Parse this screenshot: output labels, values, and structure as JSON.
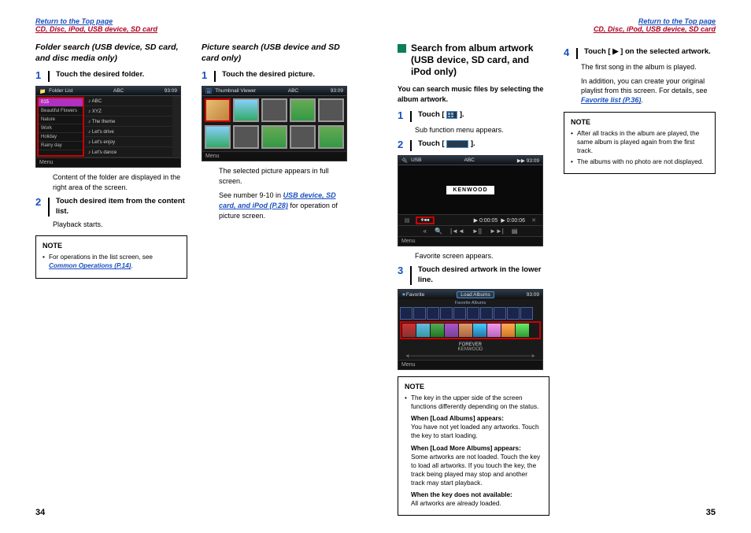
{
  "topLink": "Return to the Top page",
  "breadcrumb": "CD, Disc, iPod, USB device, SD card",
  "pageLeft": "34",
  "pageRight": "35",
  "left": {
    "colA": {
      "title": "Folder search (USB device, SD card, and disc media only)",
      "step1": "Touch the desired folder.",
      "bodyAfterShot": "Content of the folder are displayed in the right area of the screen.",
      "step2": "Touch desired item from the content list.",
      "step2sub": "Playback starts.",
      "noteTitle": "NOTE",
      "noteItemPrefix": "For operations in the list screen, see ",
      "noteLink": "Common Operations (P.14)",
      "noteItemSuffix": ".",
      "shot": {
        "header": "Folder List",
        "headerMid": "ABC",
        "headerRight": "93:09",
        "leftItems": [
          "015",
          "Beautiful Flowers",
          "Nature",
          "Work",
          "Holiday",
          "Rainy day"
        ],
        "rightItems": [
          "♪ ABC",
          "♪ XYZ",
          "♪ The theme",
          "♪ Let's drive",
          "♪ Let's enjoy",
          "♪ Let's dance"
        ],
        "menu": "Menu"
      }
    },
    "colB": {
      "title": "Picture search (USB device and SD card only)",
      "step1": "Touch the desired picture.",
      "afterShot1": "The selected picture appears in full screen.",
      "afterShot2a": "See number 9-10 in ",
      "afterShot2link": "USB device, SD card, and iPod (P.28)",
      "afterShot2b": " for operation of picture screen.",
      "shot": {
        "header": "Thumbnail Viewer",
        "headerMid": "ABC",
        "headerRight": "93:09",
        "menu": "Menu"
      }
    }
  },
  "right": {
    "colA": {
      "title": "Search from album artwork (USB device, SD card, and iPod only)",
      "intro": "You can search music files by selecting the album artwork.",
      "step1pre": "Touch [ ",
      "step1post": " ].",
      "step1sub": "Sub function menu appears.",
      "step2pre": "Touch [ ",
      "step2post": " ].",
      "shotPlayer": {
        "hdrL": "USB",
        "hdrMid": "ABC",
        "hdrR": "▶▶  93:09",
        "plate": "KENWOOD",
        "time1": "▶ 0:00:05",
        "time2": "▶ 0:00:06",
        "menu": "Menu"
      },
      "afterPlayer": "Favorite screen appears.",
      "step3": "Touch desired artwork in the lower line.",
      "shotFav": {
        "hdrL": "Favorite",
        "load": "Load Albums",
        "hdrR": "93:09",
        "stripLabel": "Favorite Albums",
        "npTitle": "FOREVER",
        "npArtist": "KENWOOD",
        "menu": "Menu"
      },
      "noteTitle": "NOTE",
      "noteItem1": "The key in the upper side of the screen functions differently depending on the status.",
      "sub1t": "When [Load Albums] appears:",
      "sub1d": "You have not yet loaded any artworks. Touch the key to start loading.",
      "sub2t": "When [Load More Albums] appears:",
      "sub2d": "Some artworks are not loaded. Touch the key to load all artworks. If you touch the key, the track being played may stop and another track may start playback.",
      "sub3t": "When the key does not available:",
      "sub3d": "All artworks are already loaded."
    },
    "colB": {
      "step4pre": "Touch [ ",
      "step4icon": "▶",
      "step4post": " ] on the selected artwork.",
      "step4sub1": "The first song in the album is played.",
      "step4sub2a": "In addition, you can create your original playlist from this screen. For details, see ",
      "step4link": "Favorite list (P.36)",
      "step4sub2b": ".",
      "noteTitle": "NOTE",
      "noteItem1": "After all tracks in the album are played, the same album is played again from the first track.",
      "noteItem2": "The albums with no photo are not displayed."
    }
  }
}
